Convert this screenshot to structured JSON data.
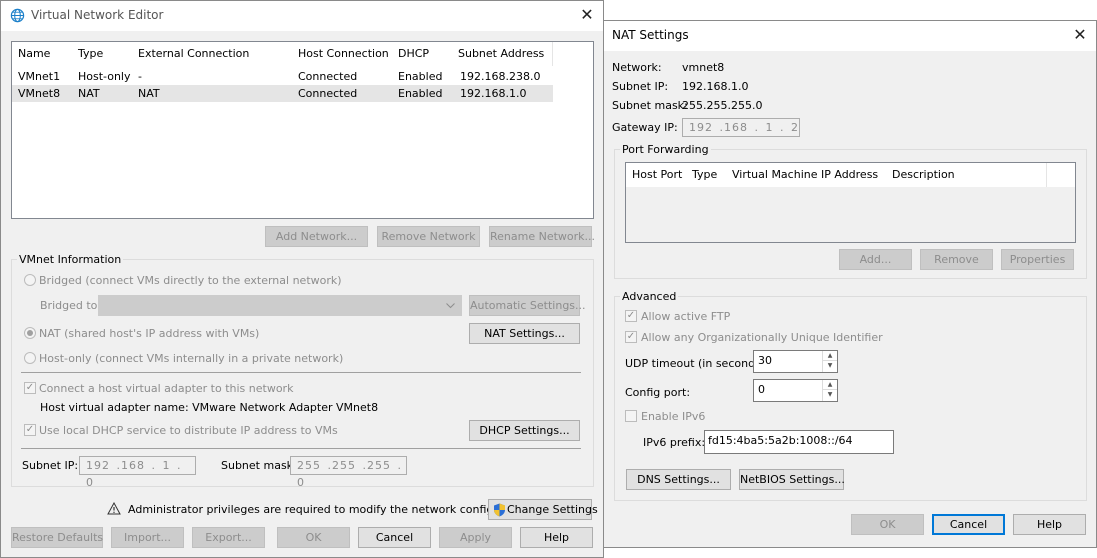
{
  "vne": {
    "title": "Virtual Network Editor",
    "columns": [
      "Name",
      "Type",
      "External Connection",
      "Host Connection",
      "DHCP",
      "Subnet Address"
    ],
    "rows": [
      [
        "VMnet1",
        "Host-only",
        "-",
        "Connected",
        "Enabled",
        "192.168.238.0"
      ],
      [
        "VMnet8",
        "NAT",
        "NAT",
        "Connected",
        "Enabled",
        "192.168.1.0"
      ]
    ],
    "add_network": "Add Network...",
    "remove_network": "Remove Network",
    "rename_network": "Rename Network...",
    "vmnet_info": "VMnet Information",
    "bridged": "Bridged (connect VMs directly to the external network)",
    "bridged_to": "Bridged to:",
    "automatic_settings": "Automatic Settings...",
    "nat": "NAT (shared host's IP address with VMs)",
    "nat_settings": "NAT Settings...",
    "host_only": "Host-only (connect VMs internally in a private network)",
    "connect_adapter": "Connect a host virtual adapter to this network",
    "adapter_name": "Host virtual adapter name: VMware Network Adapter VMnet8",
    "use_dhcp": "Use local DHCP service to distribute IP address to VMs",
    "dhcp_settings": "DHCP Settings...",
    "subnet_ip_label": "Subnet IP:",
    "subnet_ip_value": "192 .168 . 1 . 0",
    "subnet_mask_label": "Subnet mask:",
    "subnet_mask_value": "255 .255 .255 . 0",
    "admin_warning": "Administrator privileges are required to modify the network configuration.",
    "change_settings": "Change Settings",
    "restore_defaults": "Restore Defaults",
    "import": "Import...",
    "export": "Export...",
    "ok": "OK",
    "cancel": "Cancel",
    "apply": "Apply",
    "help": "Help"
  },
  "nat": {
    "title": "NAT Settings",
    "network_label": "Network:",
    "network_value": "vmnet8",
    "subnet_ip_label": "Subnet IP:",
    "subnet_ip_value": "192.168.1.0",
    "subnet_mask_label": "Subnet mask:",
    "subnet_mask_value": "255.255.255.0",
    "gateway_label": "Gateway IP:",
    "gateway_value": "192 .168 . 1 . 2",
    "port_forwarding": "Port Forwarding",
    "pf_columns": [
      "Host Port",
      "Type",
      "Virtual Machine IP Address",
      "Description"
    ],
    "add": "Add...",
    "remove": "Remove",
    "properties": "Properties",
    "advanced": "Advanced",
    "allow_ftp": "Allow active FTP",
    "allow_oui": "Allow any Organizationally Unique Identifier",
    "udp_label": "UDP timeout (in seconds):",
    "udp_value": "30",
    "config_port_label": "Config port:",
    "config_port_value": "0",
    "enable_ipv6": "Enable IPv6",
    "ipv6_prefix_label": "IPv6 prefix:",
    "ipv6_prefix_value": "fd15:4ba5:5a2b:1008::/64",
    "dns_settings": "DNS Settings...",
    "netbios_settings": "NetBIOS Settings...",
    "ok": "OK",
    "cancel": "Cancel",
    "help": "Help"
  },
  "colors": {
    "accent": "#0078d7",
    "selection": "#e5e5e5",
    "window_bg": "#f0f0f0",
    "disabled_text": "#8d8d8d"
  }
}
